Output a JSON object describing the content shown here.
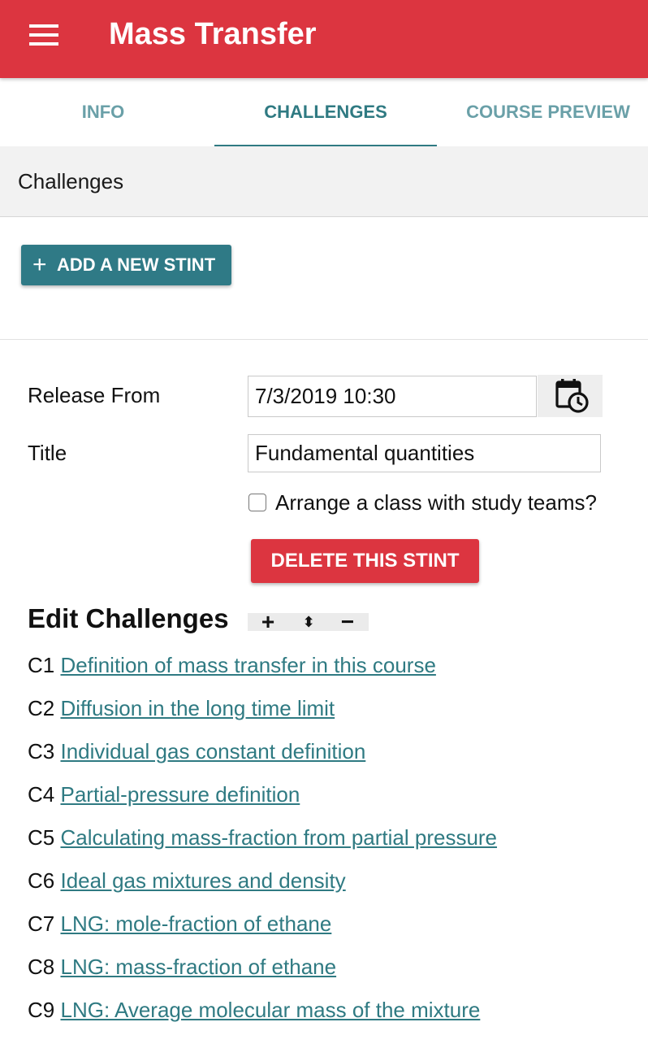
{
  "app": {
    "title": "Mass Transfer"
  },
  "tabs": [
    {
      "label": "INFO"
    },
    {
      "label": "CHALLENGES"
    },
    {
      "label": "COURSE PREVIEW"
    }
  ],
  "subheader": {
    "title": "Challenges"
  },
  "actions": {
    "add_stint_label": "ADD A NEW STINT",
    "delete_stint_label": "DELETE THIS STINT"
  },
  "form": {
    "release_from_label": "Release From",
    "release_from_value": "7/3/2019 10:30",
    "title_label": "Title",
    "title_value": "Fundamental quantities",
    "study_teams_label": "Arrange a class with study teams?",
    "study_teams_checked": false
  },
  "edit_challenges": {
    "heading": "Edit Challenges",
    "tools": {
      "add": "+",
      "reorder": "⬍",
      "remove": "−"
    }
  },
  "challenges": [
    {
      "code": "C1",
      "title": "Definition of mass transfer in this course"
    },
    {
      "code": "C2",
      "title": "Diffusion in the long time limit"
    },
    {
      "code": "C3",
      "title": "Individual gas constant definition"
    },
    {
      "code": "C4",
      "title": "Partial-pressure definition"
    },
    {
      "code": "C5",
      "title": "Calculating mass-fraction from partial pressure"
    },
    {
      "code": "C6",
      "title": "Ideal gas mixtures and density"
    },
    {
      "code": "C7",
      "title": "LNG: mole-fraction of ethane"
    },
    {
      "code": "C8",
      "title": "LNG: mass-fraction of ethane"
    },
    {
      "code": "C9",
      "title": "LNG: Average molecular mass of the mixture"
    }
  ],
  "colors": {
    "accent_red": "#dc3540",
    "teal": "#2f7a82",
    "tab_inactive": "#6aa0a8"
  }
}
